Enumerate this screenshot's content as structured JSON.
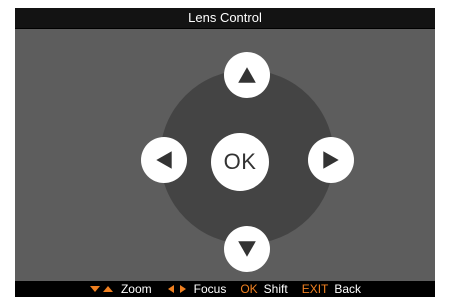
{
  "window": {
    "title": "Lens Control"
  },
  "dpad": {
    "ok_label": "OK"
  },
  "footer": {
    "zoom_label": "Zoom",
    "focus_label": "Focus",
    "ok_key": "OK",
    "shift_label": "Shift",
    "exit_key": "EXIT",
    "back_label": "Back"
  },
  "colors": {
    "accent": "#f08020",
    "panel_bg": "#5d5d5d",
    "dpad_bg": "#444444",
    "button_bg": "#ffffff",
    "arrow": "#333333"
  },
  "icons": {
    "up": "arrow-up-icon",
    "down": "arrow-down-icon",
    "left": "arrow-left-icon",
    "right": "arrow-right-icon",
    "zoom": "zoom-arrows-icon",
    "focus": "focus-arrows-icon"
  }
}
